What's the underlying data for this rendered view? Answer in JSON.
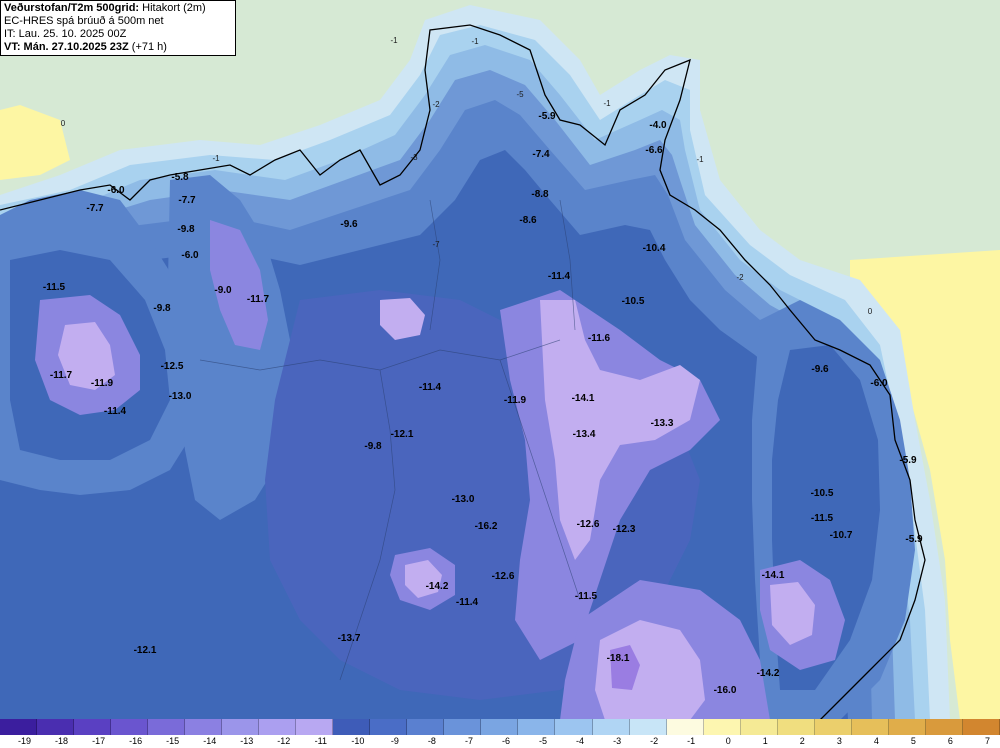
{
  "header": {
    "title_main": "Veðurstofan/T2m 500grid:",
    "title_sub": "Hitakort (2m)",
    "model_line": "EC-HRES spá brúuð á 500m net",
    "init_line": "IT: Lau. 25. 10. 2025 00Z",
    "valid_bold": "VT: Mán. 27.10.2025 23Z",
    "valid_light": "(+71 h)"
  },
  "colors": {
    "sea_green": "#d6e9d4",
    "sea_yellow": "#fdf6a3",
    "coast_light": "#cfe6f4",
    "level_m1": "#a9d2ef",
    "level_m3": "#8fbbe6",
    "level_m5": "#6f98d6",
    "level_m7": "#5a84cb",
    "level_m9": "#3f68b8",
    "level_m11": "#4a65bd",
    "level_m12": "#8b86e0",
    "level_m14": "#c2aef0",
    "level_m16": "#9a7de2",
    "outline": "#000000"
  },
  "labels": [
    {
      "text": "-6.0"
    },
    {
      "text": "-7.7"
    },
    {
      "text": "-5.8"
    },
    {
      "text": "-7.7"
    },
    {
      "text": "-9.8"
    },
    {
      "text": "-6.0"
    },
    {
      "text": "-9.0"
    },
    {
      "text": "-11.7"
    },
    {
      "text": "-11.5"
    },
    {
      "text": "-9.8"
    },
    {
      "text": "-12.5"
    },
    {
      "text": "-11.7"
    },
    {
      "text": "-11.9"
    },
    {
      "text": "-13.0"
    },
    {
      "text": "-11.4"
    },
    {
      "text": "-9.6"
    },
    {
      "text": "-5.9"
    },
    {
      "text": "-7.4"
    },
    {
      "text": "-8.8"
    },
    {
      "text": "-8.6"
    },
    {
      "text": "-10.4"
    },
    {
      "text": "-4.0"
    },
    {
      "text": "-6.6"
    },
    {
      "text": "-11.4"
    },
    {
      "text": "-10.5"
    },
    {
      "text": "-11.6"
    },
    {
      "text": "-11.4"
    },
    {
      "text": "-11.9"
    },
    {
      "text": "-14.1"
    },
    {
      "text": "-13.3"
    },
    {
      "text": "-13.4"
    },
    {
      "text": "-12.1"
    },
    {
      "text": "-9.8"
    },
    {
      "text": "-9.6"
    },
    {
      "text": "-6.0"
    },
    {
      "text": "-5.9"
    },
    {
      "text": "-10.5"
    },
    {
      "text": "-11.5"
    },
    {
      "text": "-10.7"
    },
    {
      "text": "-5.9"
    },
    {
      "text": "-13.0"
    },
    {
      "text": "-16.2"
    },
    {
      "text": "-12.6"
    },
    {
      "text": "-12.3"
    },
    {
      "text": "-14.2"
    },
    {
      "text": "-12.6"
    },
    {
      "text": "-11.4"
    },
    {
      "text": "-11.5"
    },
    {
      "text": "-14.1"
    },
    {
      "text": "-13.7"
    },
    {
      "text": "-12.1"
    },
    {
      "text": "-18.1"
    },
    {
      "text": "-14.2"
    },
    {
      "text": "-16.0"
    }
  ],
  "minor_labels": [
    {
      "text": "0"
    },
    {
      "text": "0"
    },
    {
      "text": "-1"
    },
    {
      "text": "-1"
    },
    {
      "text": "-1"
    },
    {
      "text": "-1"
    },
    {
      "text": "-1"
    },
    {
      "text": "-2"
    },
    {
      "text": "-2"
    },
    {
      "text": "-3"
    },
    {
      "text": "-5"
    },
    {
      "text": "-7"
    }
  ],
  "legend": {
    "colors": [
      "#3b1e9e",
      "#4a2eb0",
      "#5a40c2",
      "#6a55cf",
      "#7a6bd9",
      "#8b80e2",
      "#9b95ea",
      "#ab9ff0",
      "#b8a8f2",
      "#3e5cb8",
      "#4a6dc6",
      "#5a80d0",
      "#6a93da",
      "#7aa5e2",
      "#8ab5ea",
      "#9cc5f0",
      "#b0d5f4",
      "#c8e5f7",
      "#fdfbe0",
      "#fdf6b0",
      "#f5ea95",
      "#f0de7f",
      "#ebcf6c",
      "#e6bf5a",
      "#e0ad4a",
      "#d99a3c",
      "#d2862f"
    ],
    "ticks": [
      "-19",
      "-18",
      "-17",
      "-16",
      "-15",
      "-14",
      "-13",
      "-12",
      "-11",
      "-10",
      "-9",
      "-8",
      "-7",
      "-6",
      "-5",
      "-4",
      "-3",
      "-2",
      "-1",
      "0",
      "1",
      "2",
      "3",
      "4",
      "5",
      "6",
      "7"
    ]
  }
}
